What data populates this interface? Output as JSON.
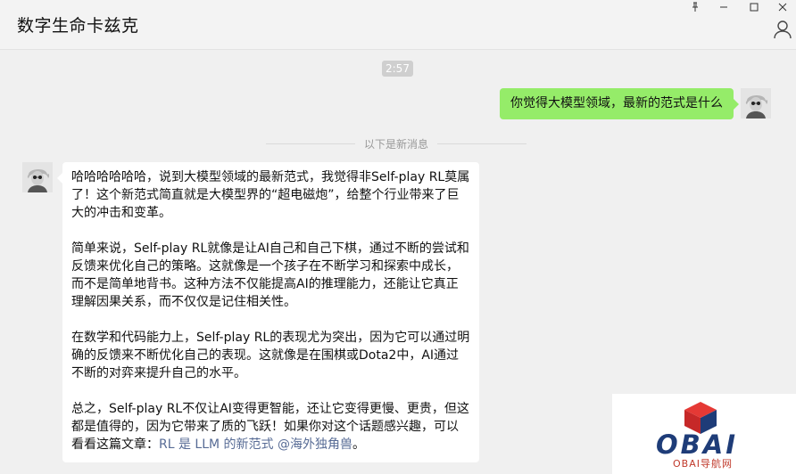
{
  "window": {
    "title": "数字生命卡兹克",
    "controls": {
      "pin": "⊥",
      "minimize": "—",
      "maximize": "☐",
      "close": "✕"
    }
  },
  "chat": {
    "time": "2:57",
    "outgoing_message": "你觉得大模型领域，最新的范式是什么",
    "divider": "以下是新消息",
    "reply": {
      "p1": "哈哈哈哈哈哈，说到大模型领域的最新范式，我觉得非Self-play RL莫属了！这个新范式简直就是大模型界的“超电磁炮”，给整个行业带来了巨大的冲击和变革。",
      "p2": "简单来说，Self-play RL就像是让AI自己和自己下棋，通过不断的尝试和反馈来优化自己的策略。这就像是一个孩子在不断学习和探索中成长，而不是简单地背书。这种方法不仅能提高AI的推理能力，还能让它真正理解因果关系，而不仅仅是记住相关性。",
      "p3": "在数学和代码能力上，Self-play RL的表现尤为突出，因为它可以通过明确的反馈来不断优化自己的表现。这就像是在围棋或Dota2中，AI通过不断的对弈来提升自己的水平。",
      "p4_text": "总之，Self-play RL不仅让AI变得更智能，还让它变得更慢、更贵，但这都是值得的，因为它带来了质的飞跃！如果你对这个话题感兴趣，可以看看这篇文章：",
      "p4_link": "RL 是 LLM 的新范式 @海外独角兽",
      "p4_end": "。"
    }
  },
  "watermark": {
    "logo_text": "OBAI",
    "sub_text": "OBAI导航网",
    "colors": {
      "cube": "#d62828",
      "text": "#1e3c78",
      "sub": "#c0392b"
    }
  },
  "colors": {
    "background": "#f0f0f0",
    "outgoing_bubble": "#95ec69",
    "incoming_bubble": "#ffffff",
    "link": "#576b95"
  },
  "icons": [
    "pin-icon",
    "minimize-icon",
    "maximize-icon",
    "close-icon",
    "profile-icon",
    "avatar"
  ]
}
